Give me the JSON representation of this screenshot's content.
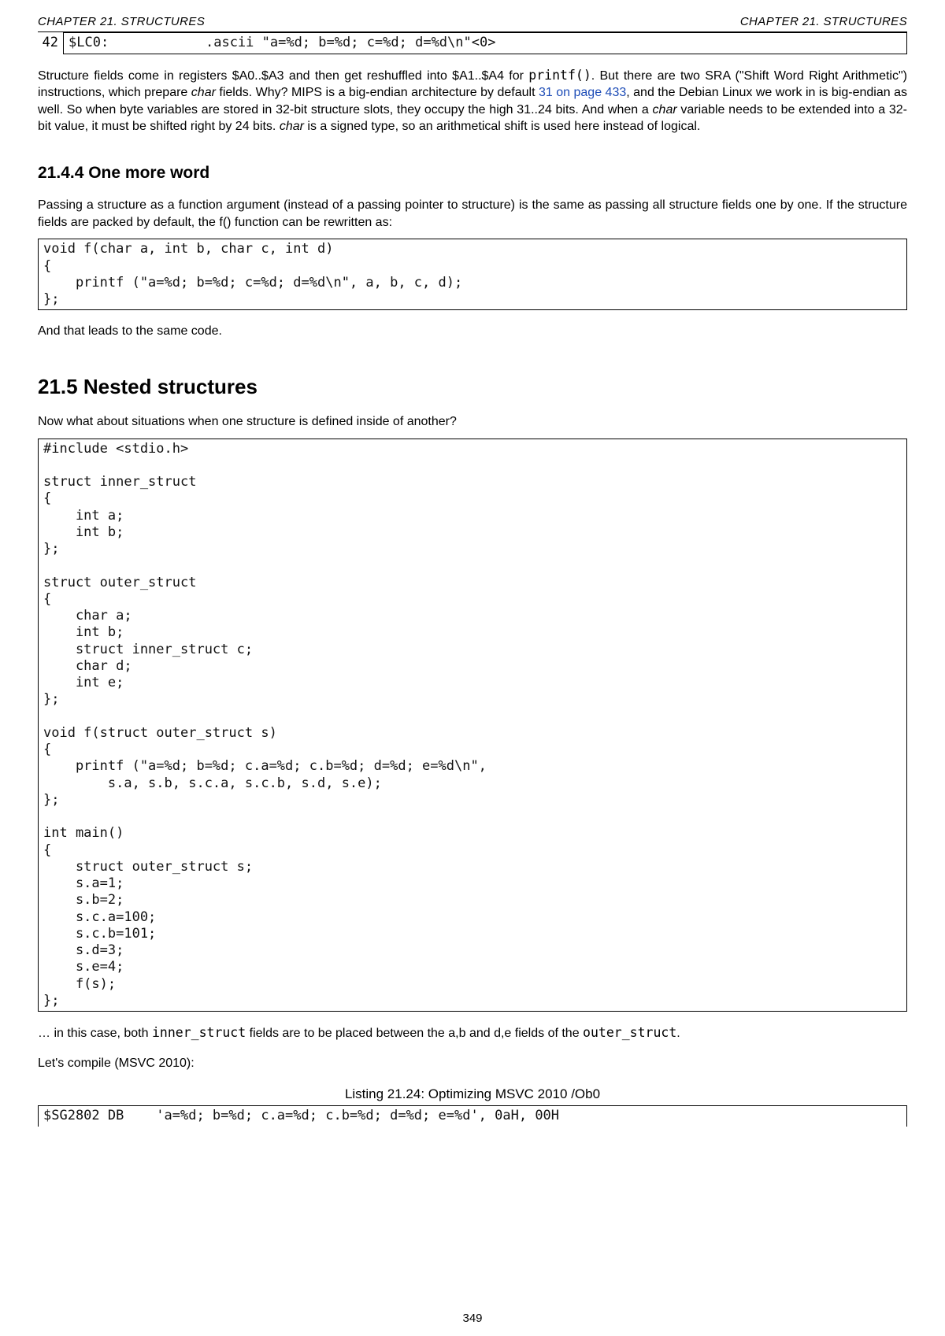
{
  "header": {
    "left": "CHAPTER 21.  STRUCTURES",
    "right": "CHAPTER 21.  STRUCTURES"
  },
  "code_cont": {
    "lineno": "42",
    "text": "$LC0:            .ascii \"a=%d; b=%d; c=%d; d=%d\\n\"<0>"
  },
  "intro_para_a": "Structure fields come in registers $A0..$A3 and then get reshuffled into $A1..$A4 for ",
  "intro_printf": "printf()",
  "intro_para_b": ".   But there are two SRA (\"Shift Word Right Arithmetic\") instructions, which prepare ",
  "intro_char1": "char",
  "intro_para_c": " fields.  Why?  MIPS is a big-endian architecture by default ",
  "intro_link": "31 on page 433",
  "intro_para_d": ", and the Debian Linux we work in is big-endian as well.   So when byte variables are stored in 32-bit structure slots, they occupy the high 31..24 bits.   And when a ",
  "intro_char2": "char",
  "intro_para_e": " variable needs to be extended into a 32-bit value, it must be shifted right by 24 bits.   ",
  "intro_char3": "char",
  "intro_para_f": " is a signed type, so an arithmetical shift is used here instead of logical.",
  "subsec_head": "21.4.4   One more word",
  "subsec_para": "Passing a structure as a function argument (instead of a passing pointer to structure) is the same as passing all structure fields one by one.   If the structure fields are packed by default, the f() function can be rewritten as:",
  "code_f": "void f(char a, int b, char c, int d)\n{\n    printf (\"a=%d; b=%d; c=%d; d=%d\\n\", a, b, c, d);\n};",
  "leads": "And that leads to the same code.",
  "sec_head": "21.5    Nested structures",
  "sec_para": "Now what about situations when one structure is defined inside of another?",
  "code_nested": "#include <stdio.h>\n\nstruct inner_struct\n{\n    int a;\n    int b;\n};\n\nstruct outer_struct\n{\n    char a;\n    int b;\n    struct inner_struct c;\n    char d;\n    int e;\n};\n\nvoid f(struct outer_struct s)\n{\n    printf (\"a=%d; b=%d; c.a=%d; c.b=%d; d=%d; e=%d\\n\",\n        s.a, s.b, s.c.a, s.c.b, s.d, s.e);\n};\n\nint main()\n{\n    struct outer_struct s;\n    s.a=1;\n    s.b=2;\n    s.c.a=100;\n    s.c.b=101;\n    s.d=3;\n    s.e=4;\n    f(s);\n};",
  "tail_a": "… in this case, both ",
  "tail_inner": "inner_struct",
  "tail_b": " fields are to be placed between the a,b and d,e fields of the ",
  "tail_outer": "outer_struct",
  "tail_c": ".",
  "compile": "Let's compile (MSVC 2010):",
  "listing_caption": "Listing 21.24: Optimizing MSVC 2010 /Ob0",
  "code_listing": "$SG2802 DB    'a=%d; b=%d; c.a=%d; c.b=%d; d=%d; e=%d', 0aH, 00H\n",
  "page_number": "349"
}
